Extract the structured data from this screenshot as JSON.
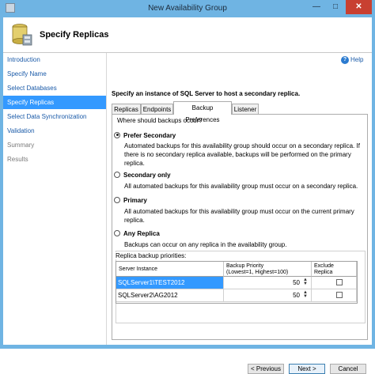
{
  "window": {
    "title": "New Availability Group",
    "minimize_glyph": "—",
    "maximize_glyph": "□",
    "close_glyph": "✕"
  },
  "header": {
    "title": "Specify Replicas",
    "icon": "database-wizard-icon"
  },
  "nav": {
    "items": [
      {
        "label": "Introduction",
        "state": "normal"
      },
      {
        "label": "Specify Name",
        "state": "normal"
      },
      {
        "label": "Select Databases",
        "state": "normal"
      },
      {
        "label": "Specify Replicas",
        "state": "active"
      },
      {
        "label": "Select Data Synchronization",
        "state": "normal"
      },
      {
        "label": "Validation",
        "state": "normal"
      },
      {
        "label": "Summary",
        "state": "disabled"
      },
      {
        "label": "Results",
        "state": "disabled"
      }
    ]
  },
  "help": {
    "label": "Help",
    "icon_glyph": "?"
  },
  "instruction": "Specify an instance of SQL Server to host a secondary replica.",
  "tabs": [
    {
      "label": "Replicas",
      "active": false
    },
    {
      "label": "Endpoints",
      "active": false
    },
    {
      "label": "Backup Preferences",
      "active": true
    },
    {
      "label": "Listener",
      "active": false
    }
  ],
  "backup": {
    "question": "Where should backups occur?",
    "options": [
      {
        "label": "Prefer Secondary",
        "checked": true,
        "description": "Automated backups for this availability group should occur on a secondary replica. If there is no secondary replica available, backups will be performed on the primary replica."
      },
      {
        "label": "Secondary only",
        "checked": false,
        "description": "All automated backups for this availability group must occur on a secondary replica."
      },
      {
        "label": "Primary",
        "checked": false,
        "description": "All automated backups for this availability group must occur on the current primary replica."
      },
      {
        "label": "Any Replica",
        "checked": false,
        "description": "Backups can occur on any replica in the availability group."
      }
    ]
  },
  "priorities": {
    "group_label": "Replica backup priorities:",
    "columns": {
      "server": "Server Instance",
      "priority_line1": "Backup Priority",
      "priority_line2": "(Lowest=1, Highest=100)",
      "exclude_line1": "Exclude",
      "exclude_line2": "Replica"
    },
    "rows": [
      {
        "server": "SQLServer1",
        "server_suffix": "\\TEST2012",
        "priority": "50",
        "exclude": false,
        "selected": true
      },
      {
        "server": "SQLServer2",
        "server_suffix": "\\AG2012",
        "priority": "50",
        "exclude": false,
        "selected": false
      }
    ],
    "spin_up": "▲",
    "spin_down": "▼"
  },
  "footer": {
    "previous": "< Previous",
    "next": "Next >",
    "cancel": "Cancel"
  }
}
